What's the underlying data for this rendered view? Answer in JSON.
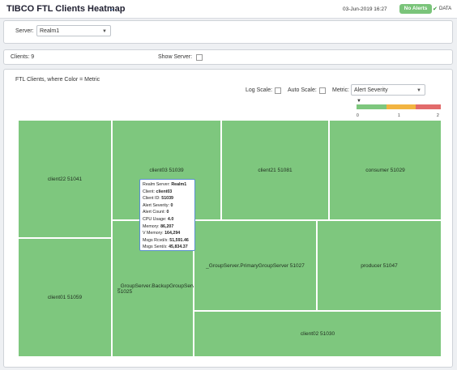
{
  "header": {
    "title": "TIBCO FTL Clients Heatmap",
    "timestamp": "03-Jun-2019 16:27",
    "alerts_badge": "No Alerts",
    "data_label": "DATA"
  },
  "server_filter": {
    "label": "Server:",
    "value": "Realm1"
  },
  "summary": {
    "clients_label": "Clients: 9",
    "show_server_label": "Show Server:"
  },
  "heatmap": {
    "heading": "FTL Clients, where Color = Metric",
    "log_scale_label": "Log Scale:",
    "auto_scale_label": "Auto Scale:",
    "metric_label": "Metric:",
    "metric_value": "Alert Severity",
    "legend": {
      "min": "0",
      "mid": "1",
      "max": "2"
    },
    "tiles": [
      {
        "label": "client22 51041"
      },
      {
        "label": "client03 51039"
      },
      {
        "label": "client21 51081"
      },
      {
        "label": "consumer 51029"
      },
      {
        "label": "client01 51059"
      },
      {
        "label": "_GroupServer.BackupGroupServer 51025"
      },
      {
        "label": "_GroupServer.PrimaryGroupServer 51027"
      },
      {
        "label": "producer 51047"
      },
      {
        "label": "client02 51030"
      }
    ],
    "tooltip": [
      {
        "k": "Realm Server: ",
        "v": "Realm1"
      },
      {
        "k": "Client: ",
        "v": "client03"
      },
      {
        "k": "Client ID: ",
        "v": "51039"
      },
      {
        "k": "Alert Severity: ",
        "v": "0"
      },
      {
        "k": "Alert Count: ",
        "v": "0"
      },
      {
        "k": "CPU Usage: ",
        "v": "4.0"
      },
      {
        "k": "Memory: ",
        "v": "86,207"
      },
      {
        "k": "V Memory: ",
        "v": "164,294"
      },
      {
        "k": "Msgs Rcvd/s: ",
        "v": "51,591.46"
      },
      {
        "k": "Msgs Sent/s: ",
        "v": "45,834.37"
      }
    ]
  },
  "colors": {
    "tile_green": "#7ec77e",
    "legend_green": "#7ec77e",
    "legend_yellow": "#f2b441",
    "legend_red": "#e26b6b"
  }
}
